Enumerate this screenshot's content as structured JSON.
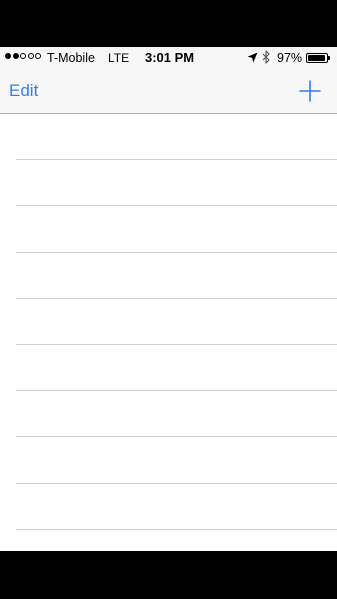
{
  "status_bar": {
    "signal_strength": 2,
    "signal_max": 5,
    "carrier": "T-Mobile",
    "network": "LTE",
    "time": "3:01 PM",
    "location_icon": "location-arrow-icon",
    "bluetooth_icon": "bluetooth-icon",
    "battery_percent": "97%",
    "battery_level": 0.97
  },
  "nav_bar": {
    "left_button_label": "Edit",
    "right_button_icon": "plus-icon",
    "tint_color": "#2f7ff0"
  },
  "list": {
    "rows": [
      "",
      "",
      "",
      "",
      "",
      "",
      "",
      "",
      ""
    ]
  }
}
